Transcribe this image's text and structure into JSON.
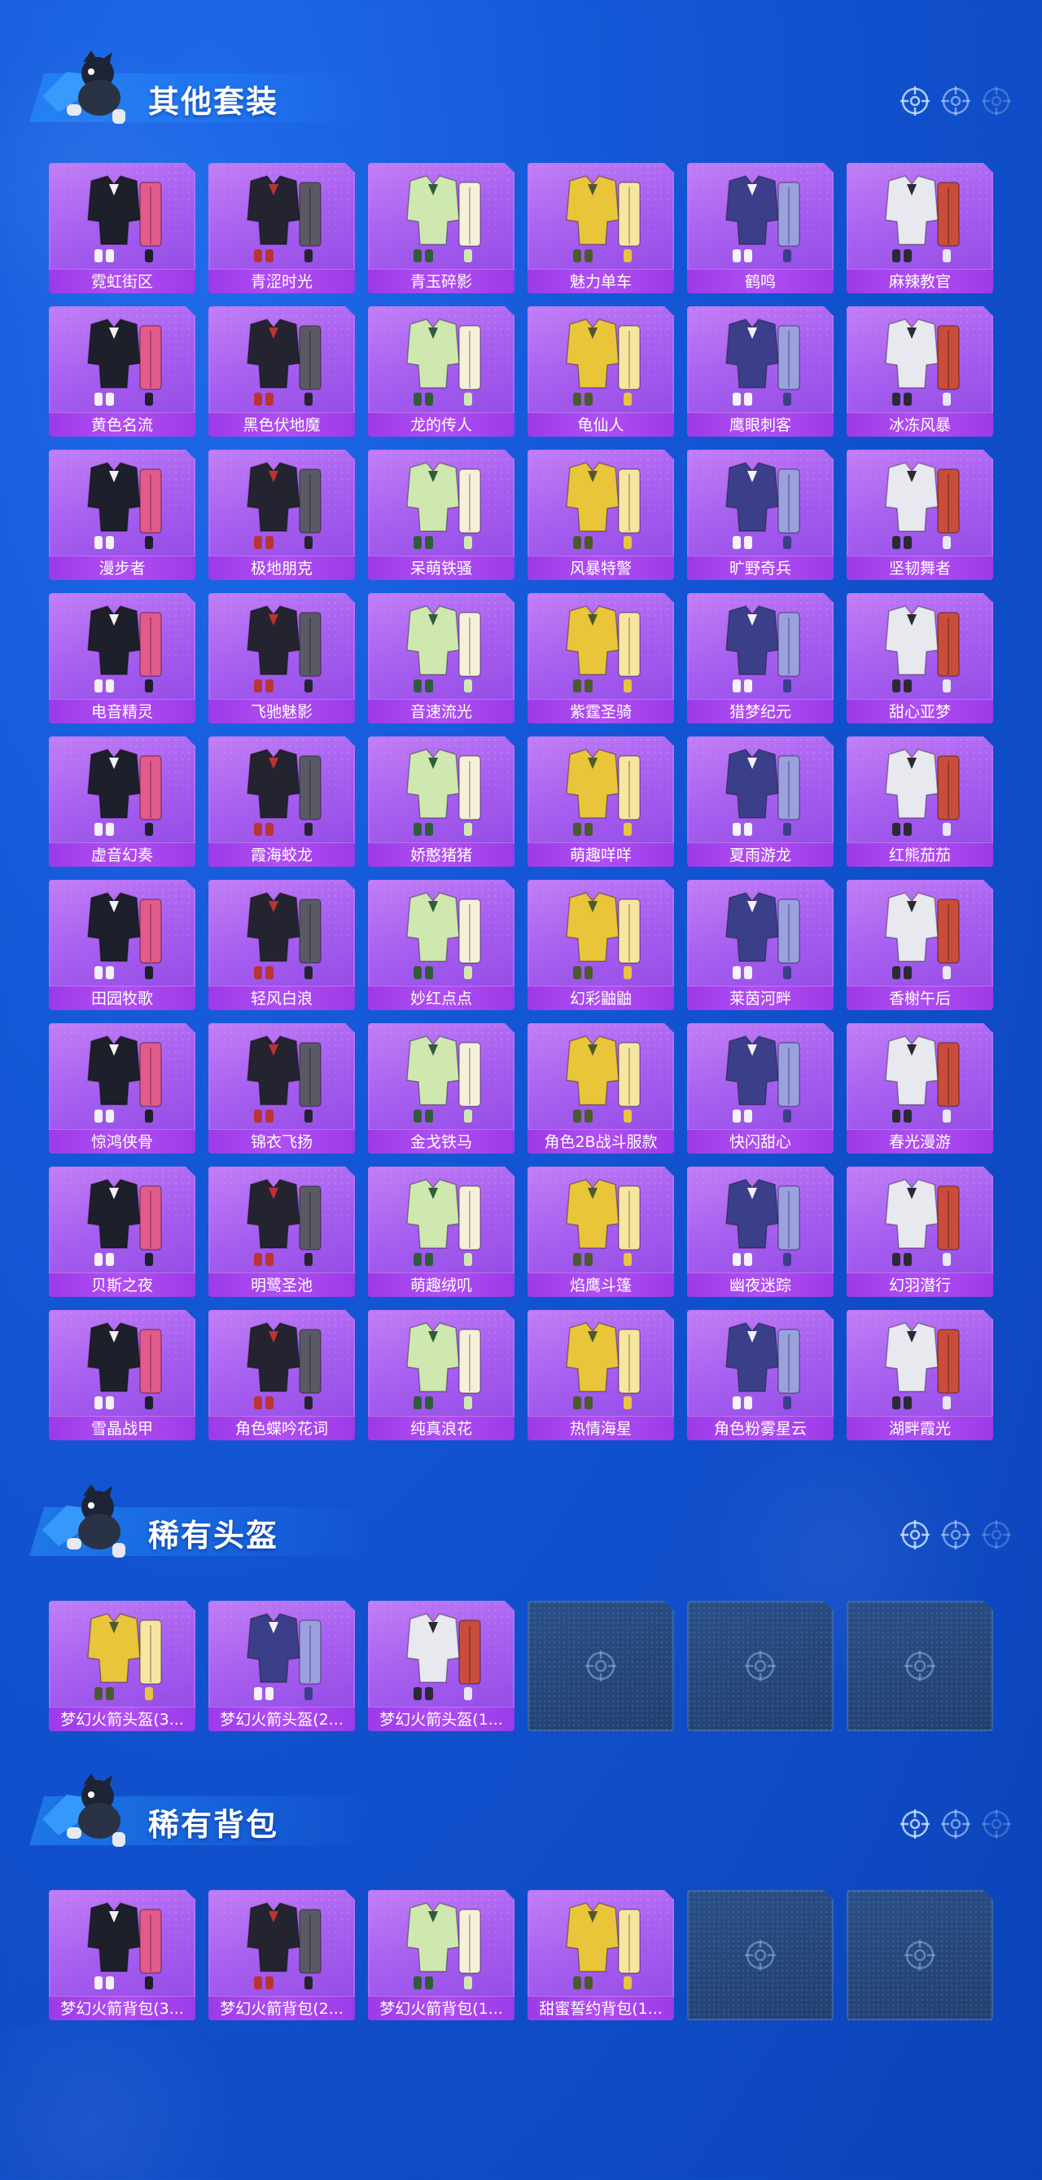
{
  "sections": [
    {
      "title": "其他套装",
      "items": [
        "霓虹街区",
        "青涩时光",
        "青玉碎影",
        "魅力单车",
        "鹤鸣",
        "麻辣教官",
        "黄色名流",
        "黑色伏地魔",
        "龙的传人",
        "龟仙人",
        "鹰眼刺客",
        "冰冻风暴",
        "漫步者",
        "极地朋克",
        "呆萌铁骚",
        "风暴特警",
        "旷野奇兵",
        "坚韧舞者",
        "电音精灵",
        "飞驰魅影",
        "音速流光",
        "紫霆圣骑",
        "猎梦纪元",
        "甜心亚梦",
        "虚音幻奏",
        "霞海蛟龙",
        "娇憨猪猪",
        "萌趣咩咩",
        "夏雨游龙",
        "红熊茄茄",
        "田园牧歌",
        "轻风白浪",
        "妙红点点",
        "幻彩鼬鼬",
        "莱茵河畔",
        "香榭午后",
        "惊鸿侠骨",
        "锦衣飞扬",
        "金戈铁马",
        "角色2B战斗服款",
        "快闪甜心",
        "春光漫游",
        "贝斯之夜",
        "明鹭圣池",
        "萌趣绒叽",
        "焰鹰斗篷",
        "幽夜迷踪",
        "幻羽潜行",
        "雪晶战甲",
        "角色蝶吟花词",
        "纯真浪花",
        "热情海星",
        "角色粉雾星云",
        "湖畔霞光"
      ],
      "empty_slots": 0
    },
    {
      "title": "稀有头盔",
      "items": [
        "梦幻火箭头盔(3...",
        "梦幻火箭头盔(2...",
        "梦幻火箭头盔(1..."
      ],
      "empty_slots": 3
    },
    {
      "title": "稀有背包",
      "items": [
        "梦幻火箭背包(3...",
        "梦幻火箭背包(2...",
        "梦幻火箭背包(1...",
        "甜蜜誓约背包(1..."
      ],
      "empty_slots": 2
    }
  ],
  "icons": {
    "header_character": "character-mascot-icon",
    "header_targets": "crosshair-target-icon",
    "empty_slot": "crosshair-target-icon"
  },
  "colors": {
    "background": "#1457d6",
    "card_purple": "#a75ff0",
    "label_purple": "#b04ff2",
    "empty_slot": "#223f70",
    "title_text": "#ffffff"
  }
}
